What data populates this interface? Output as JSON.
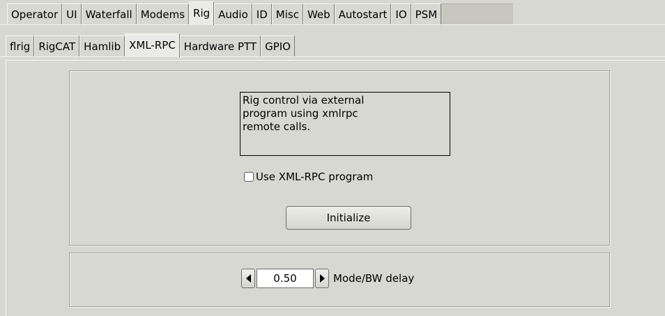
{
  "main_tabs": [
    {
      "label": "Operator",
      "active": false
    },
    {
      "label": "UI",
      "active": false
    },
    {
      "label": "Waterfall",
      "active": false
    },
    {
      "label": "Modems",
      "active": false
    },
    {
      "label": "Rig",
      "active": true
    },
    {
      "label": "Audio",
      "active": false
    },
    {
      "label": "ID",
      "active": false
    },
    {
      "label": "Misc",
      "active": false
    },
    {
      "label": "Web",
      "active": false
    },
    {
      "label": "Autostart",
      "active": false
    },
    {
      "label": "IO",
      "active": false
    },
    {
      "label": "PSM",
      "active": false
    }
  ],
  "sub_tabs": [
    {
      "label": "flrig",
      "active": false
    },
    {
      "label": "RigCAT",
      "active": false
    },
    {
      "label": "Hamlib",
      "active": false
    },
    {
      "label": "XML-RPC",
      "active": true
    },
    {
      "label": "Hardware PTT",
      "active": false
    },
    {
      "label": "GPIO",
      "active": false
    }
  ],
  "xmlrpc": {
    "info_text": "Rig control via external\nprogram using xmlrpc\nremote calls.",
    "use_checkbox_label": "Use XML-RPC program",
    "use_checkbox_checked": false,
    "initialize_label": "Initialize",
    "mode_bw_delay_value": "0.50",
    "mode_bw_delay_label": "Mode/BW delay"
  }
}
